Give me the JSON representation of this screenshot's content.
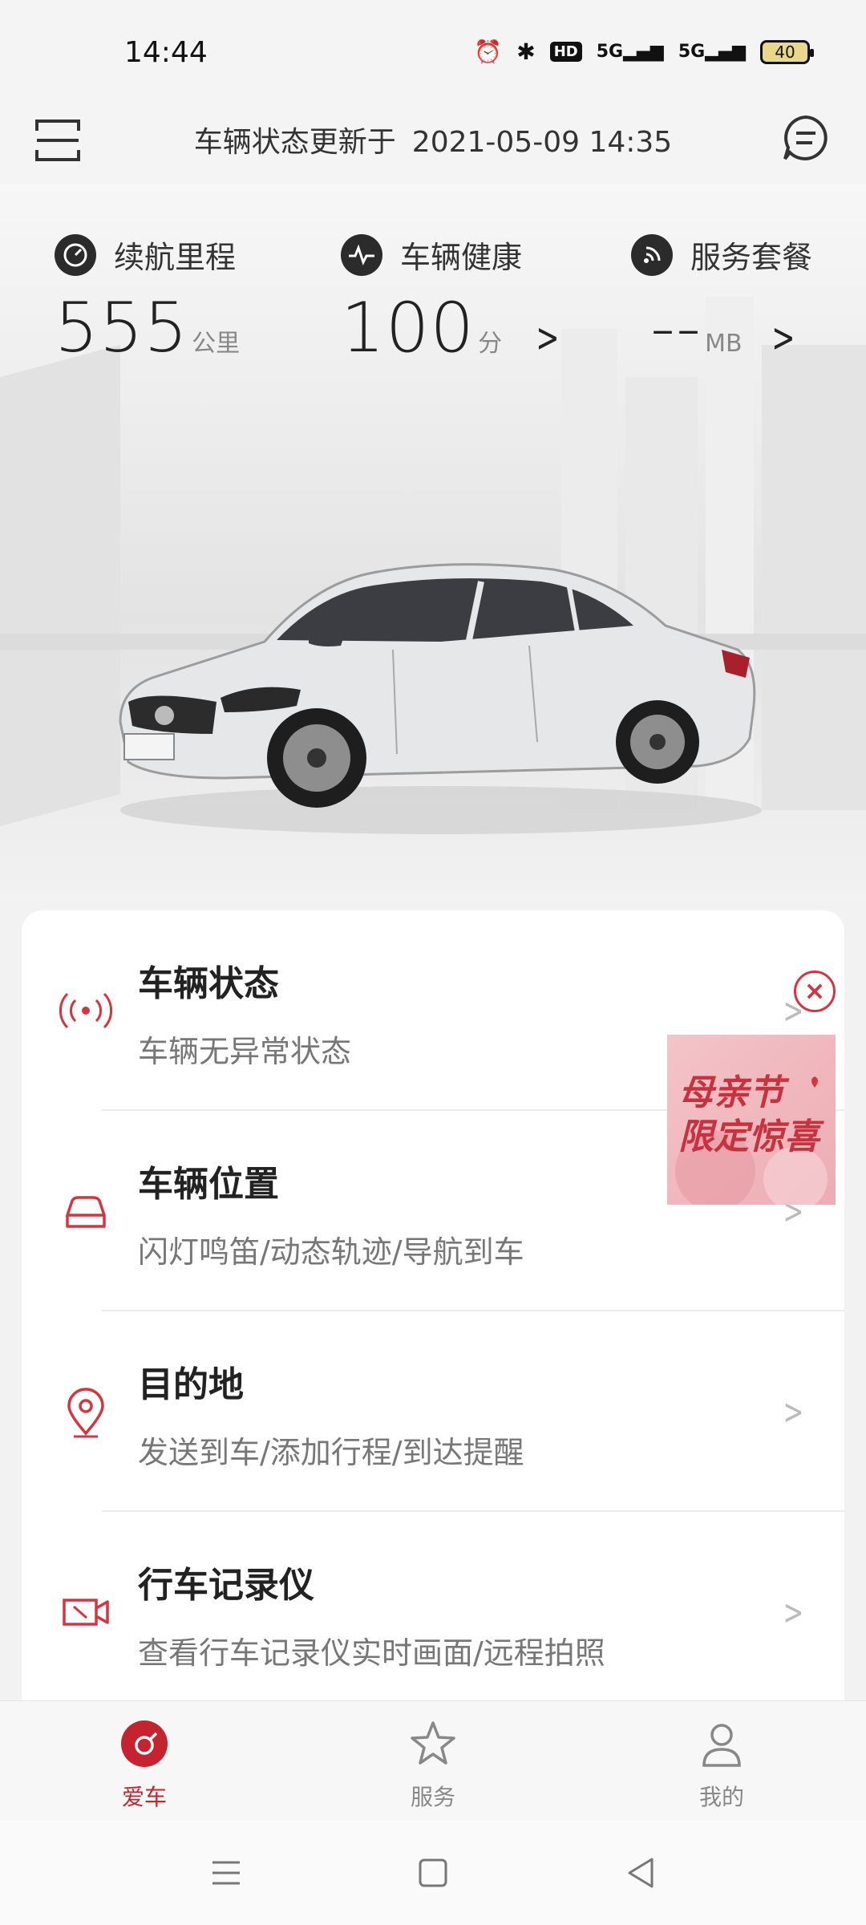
{
  "status_bar": {
    "time": "14:44",
    "hd_label": "HD",
    "signal1": "5G",
    "signal2": "5G",
    "battery": "40"
  },
  "header": {
    "title_prefix": "车辆状态更新于",
    "updated_at": "2021-05-09 14:35"
  },
  "stats": [
    {
      "label": "续航里程",
      "value": "555",
      "unit": "公里",
      "icon": "speedometer-icon"
    },
    {
      "label": "车辆健康",
      "value": "100",
      "unit": "分",
      "icon": "heartbeat-icon"
    },
    {
      "label": "服务套餐",
      "value": "--",
      "unit": "MB",
      "icon": "signal-icon"
    }
  ],
  "menu": [
    {
      "title": "车辆状态",
      "subtitle": "车辆无异常状态",
      "icon": "broadcast-icon"
    },
    {
      "title": "车辆位置",
      "subtitle": "闪灯鸣笛/动态轨迹/导航到车",
      "icon": "car-icon"
    },
    {
      "title": "目的地",
      "subtitle": "发送到车/添加行程/到达提醒",
      "icon": "location-pin-icon"
    },
    {
      "title": "行车记录仪",
      "subtitle": "查看行车记录仪实时画面/远程拍照",
      "icon": "video-camera-icon"
    }
  ],
  "promo": {
    "line1": "母亲节",
    "line2": "限定惊喜",
    "close": "×"
  },
  "bottom_nav": [
    {
      "label": "爱车",
      "active": true
    },
    {
      "label": "服务",
      "active": false
    },
    {
      "label": "我的",
      "active": false
    }
  ],
  "colors": {
    "accent": "#c4232f",
    "promo_bg": "#f0b8be"
  }
}
